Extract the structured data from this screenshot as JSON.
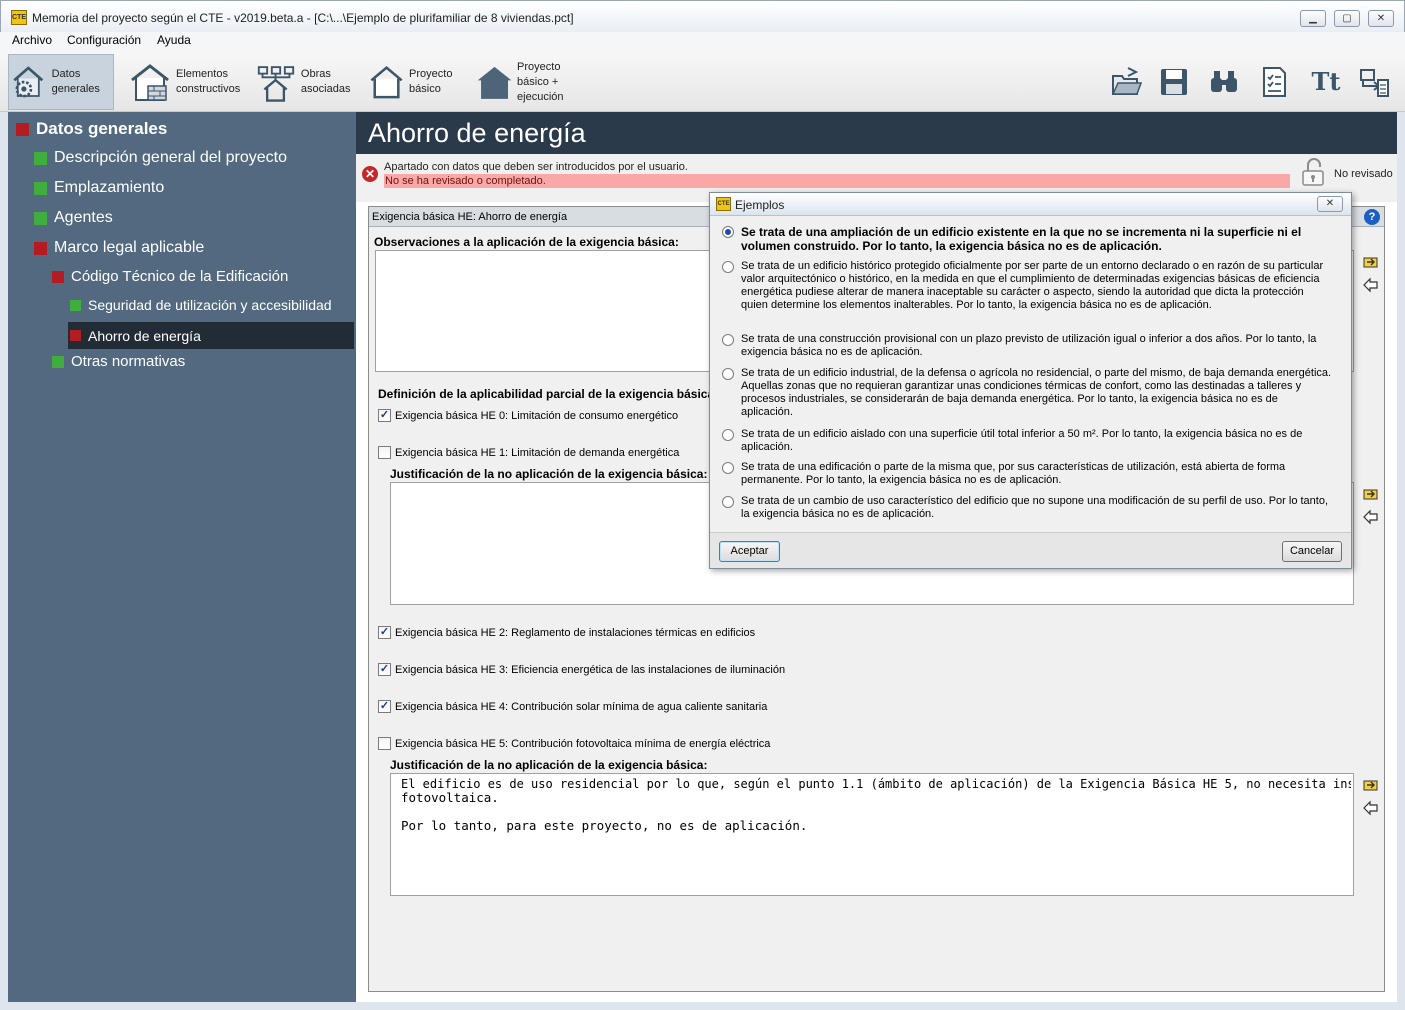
{
  "window": {
    "title": "Memoria del proyecto según el CTE - v2019.beta.a - [C:\\...\\Ejemplo de plurifamiliar de 8 viviendas.pct]",
    "app_icon_text": "CTE",
    "minimize": "▁",
    "maximize": "▢",
    "close": "✕"
  },
  "menu": {
    "items": [
      "Archivo",
      "Configuración",
      "Ayuda"
    ]
  },
  "toolbar": {
    "buttons": [
      {
        "label": "Datos generales",
        "icon": "gear-house-icon"
      },
      {
        "label": "Elementos constructivos",
        "icon": "house-wall-icon"
      },
      {
        "label": "Obras asociadas",
        "icon": "network-house-icon"
      },
      {
        "label": "Proyecto básico",
        "icon": "house-outline-icon"
      },
      {
        "label": "Proyecto básico + ejecución",
        "icon": "house-filled-icon"
      }
    ],
    "right_icons": [
      "open-folder-icon",
      "save-icon",
      "binoculars-icon",
      "report-icon",
      "font-icon",
      "export-icon"
    ],
    "font_icon_text": "Tt"
  },
  "sidebar": {
    "items": [
      {
        "label": "Datos generales",
        "status": "red"
      },
      {
        "label": "Descripción general del proyecto",
        "status": "green"
      },
      {
        "label": "Emplazamiento",
        "status": "green"
      },
      {
        "label": "Agentes",
        "status": "green"
      },
      {
        "label": "Marco legal aplicable",
        "status": "red"
      },
      {
        "label": "Código Técnico de la Edificación",
        "status": "red"
      },
      {
        "label": "Seguridad de utilización y accesibilidad",
        "status": "green"
      },
      {
        "label": "Ahorro de energía",
        "status": "red"
      },
      {
        "label": "Otras normativas",
        "status": "green"
      }
    ],
    "colors": {
      "red": "#b21c22",
      "green": "#3fae3f",
      "background": "#52697f",
      "selected": "#222c36"
    }
  },
  "main": {
    "header": "Ahorro de energía",
    "status": {
      "line1": "Apartado con datos que deben ser introducidos por el usuario.",
      "line2": "No se ha revisado o completado.",
      "review_label": "No revisado"
    },
    "panel": {
      "title": "Exigencia básica HE: Ahorro de energía",
      "help": "?",
      "observaciones_label": "Observaciones a la aplicación de la exigencia básica:",
      "observaciones_value": "",
      "definicion_label": "Definición de la aplicabilidad parcial de la exigencia básica",
      "he0": {
        "label": "Exigencia básica HE 0: Limitación de consumo energético",
        "checked": true
      },
      "he1": {
        "label": "Exigencia básica HE 1: Limitación de demanda energética",
        "checked": false
      },
      "justificacion1_label": "Justificación de la no aplicación de la exigencia básica:",
      "justificacion1_value": "",
      "he2": {
        "label": "Exigencia básica HE 2: Reglamento de instalaciones térmicas en edificios",
        "checked": true
      },
      "he3": {
        "label": "Exigencia básica HE 3: Eficiencia energética de las instalaciones de iluminación",
        "checked": true
      },
      "he4": {
        "label": "Exigencia básica HE 4: Contribución solar mínima de agua caliente sanitaria",
        "checked": true
      },
      "he5": {
        "label": "Exigencia básica HE 5: Contribución fotovoltaica mínima de energía eléctrica",
        "checked": false
      },
      "justificacion5_label": "Justificación de la no aplicación de la exigencia básica:",
      "justificacion5_line1": "El edificio es de uso residencial por lo que, según el punto 1.1 (ámbito de aplicación) de la Exigencia Básica HE 5, no necesita instalación solar",
      "justificacion5_line2": "fotovoltaica.",
      "justificacion5_line3": "Por lo tanto, para este proyecto, no es de aplicación."
    }
  },
  "dialog": {
    "title": "Ejemplos",
    "close": "✕",
    "options": [
      {
        "text": "Se trata de una ampliación de un edificio existente en la que no se incrementa ni la superficie ni el volumen construido. Por lo tanto, la exigencia básica no es de aplicación.",
        "selected": true
      },
      {
        "text": "Se trata de un edificio histórico protegido oficialmente por ser parte de un entorno declarado o en razón de su particular valor arquitectónico o histórico, en la medida en que el cumplimiento de determinadas exigencias básicas de eficiencia energética pudiese alterar de manera inaceptable su carácter o aspecto, siendo la autoridad que dicta la protección quien determine los elementos inalterables. Por lo tanto, la exigencia básica no es de aplicación.",
        "selected": false
      },
      {
        "text": "Se trata de una construcción provisional con un plazo previsto de utilización igual o inferior a dos años. Por lo tanto, la exigencia básica no es de aplicación.",
        "selected": false
      },
      {
        "text": "Se trata de un edificio industrial, de la defensa o agrícola no residencial, o parte del mismo, de baja demanda energética. Aquellas zonas que no requieran garantizar unas condiciones térmicas de confort, como las destinadas a talleres y procesos industriales, se considerarán de baja demanda energética. Por lo tanto, la exigencia básica no es de aplicación.",
        "selected": false
      },
      {
        "text": "Se trata de un edificio aislado con una superficie útil total inferior a 50 m². Por lo tanto, la exigencia básica no es de aplicación.",
        "selected": false
      },
      {
        "text": "Se trata de una edificación o parte de la misma que, por sus características de utilización, está abierta de forma permanente. Por lo tanto, la exigencia básica no es de aplicación.",
        "selected": false
      },
      {
        "text": "Se trata de un cambio de uso característico del edificio que no supone una modificación de su perfil de uso. Por lo tanto, la exigencia básica no es de aplicación.",
        "selected": false
      }
    ],
    "accept": "Aceptar",
    "cancel": "Cancelar"
  }
}
